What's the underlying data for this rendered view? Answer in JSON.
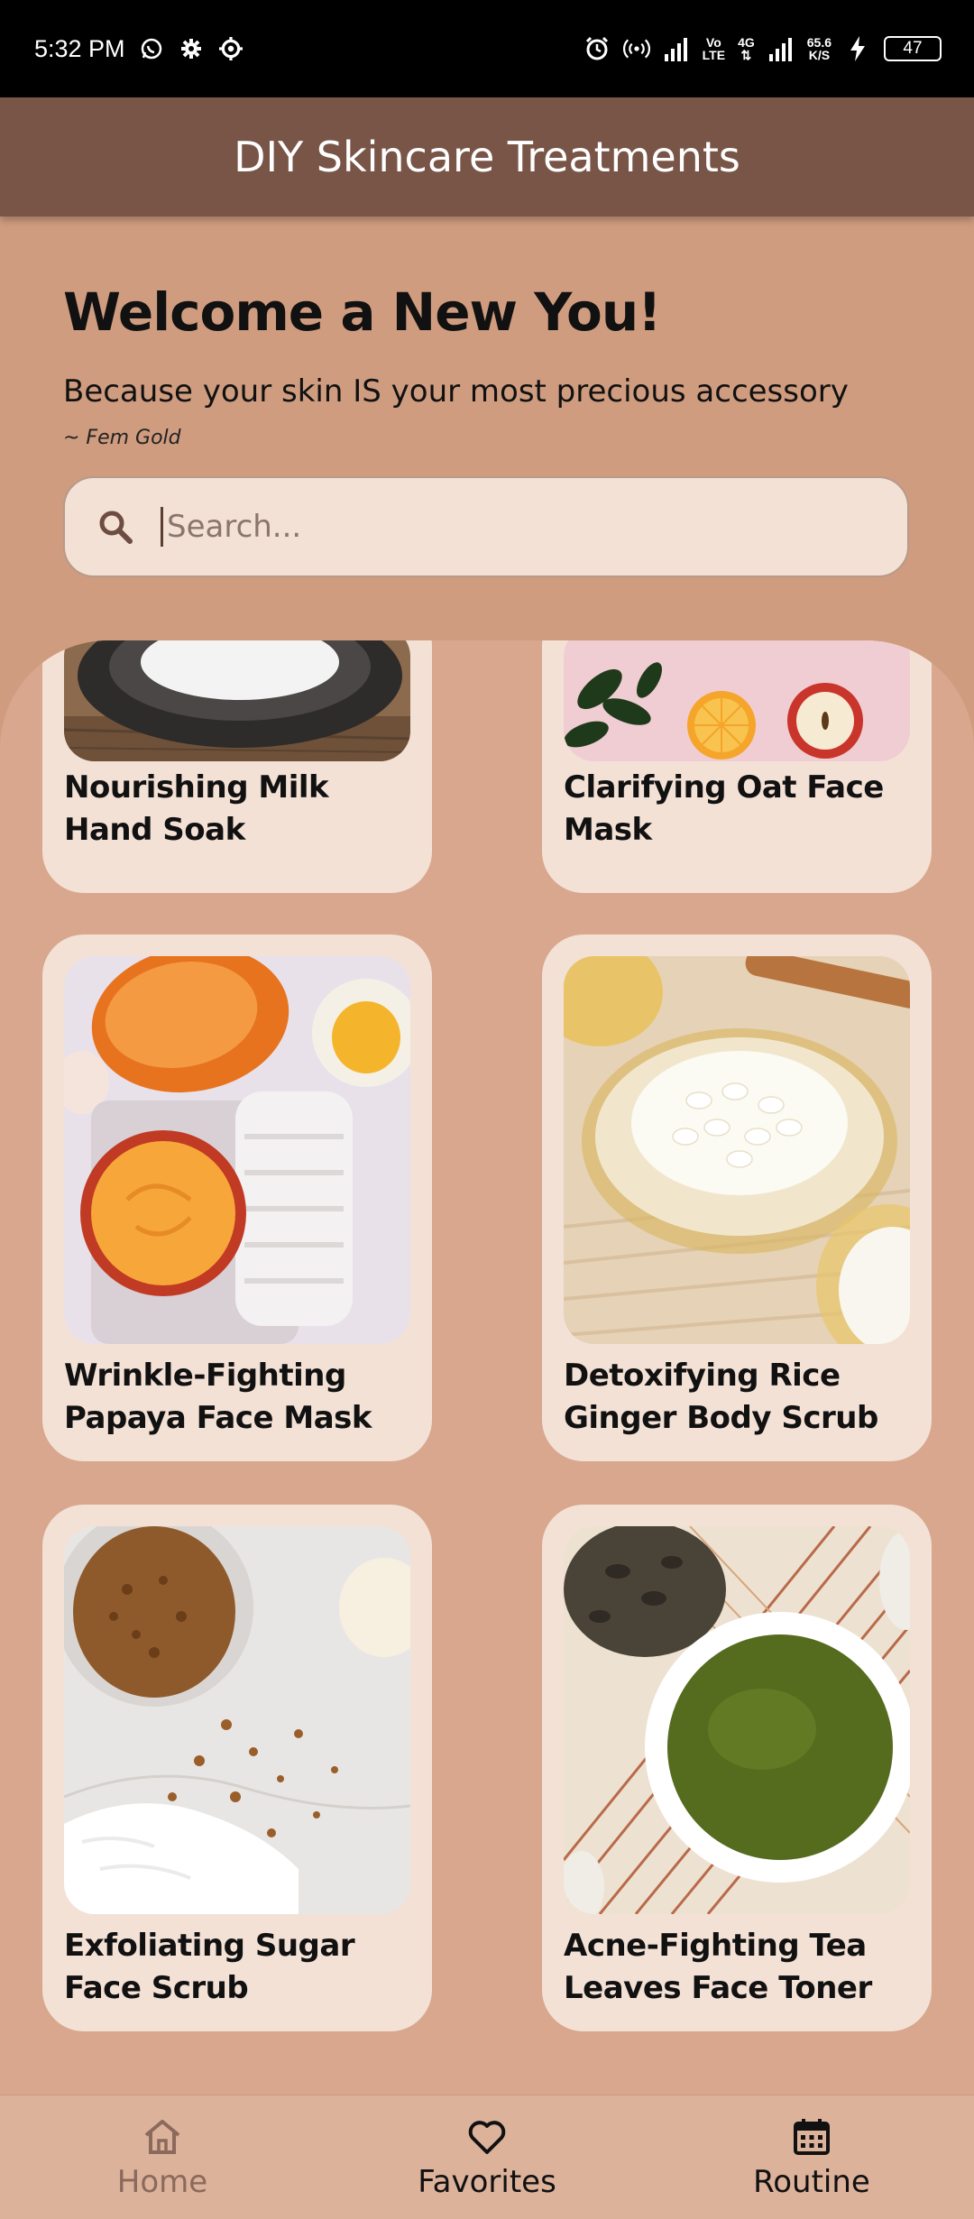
{
  "status_bar": {
    "time": "5:32 PM",
    "network_speed_top": "65.6",
    "network_speed_bottom": "K/S",
    "lte_top": "Vo",
    "lte_bottom": "LTE",
    "g4_top": "4G",
    "battery": "47",
    "icons": [
      "whatsapp-icon",
      "gear-icon",
      "gear-icon",
      "alarm-icon",
      "hotspot-icon",
      "signal-icon",
      "signal-icon",
      "charging-icon",
      "battery-icon"
    ]
  },
  "app_bar": {
    "title": "DIY Skincare Treatments"
  },
  "welcome": {
    "title": "Welcome a New You!",
    "subtitle": "Because your skin IS your most precious accessory",
    "quote_author": "~ Fem Gold"
  },
  "search": {
    "placeholder": "Search...",
    "icon": "search-icon"
  },
  "cards": [
    {
      "title": "Nourishing Milk Hand Soak"
    },
    {
      "title": "Clarifying Oat Face Mask"
    },
    {
      "title": "Wrinkle-Fighting Papaya Face Mask"
    },
    {
      "title": "Detoxifying Rice Ginger Body Scrub"
    },
    {
      "title": "Exfoliating Sugar Face Scrub"
    },
    {
      "title": "Acne-Fighting Tea Leaves Face Toner"
    }
  ],
  "bottom_nav": {
    "items": [
      {
        "label": "Home",
        "icon": "home-icon",
        "active": false
      },
      {
        "label": "Favorites",
        "icon": "heart-icon",
        "active": true
      },
      {
        "label": "Routine",
        "icon": "calendar-icon",
        "active": true
      }
    ]
  },
  "colors": {
    "app_bar": "#795548",
    "background": "#cf9c7f",
    "card": "#f3e1d6",
    "nav": "#ddb29b"
  }
}
